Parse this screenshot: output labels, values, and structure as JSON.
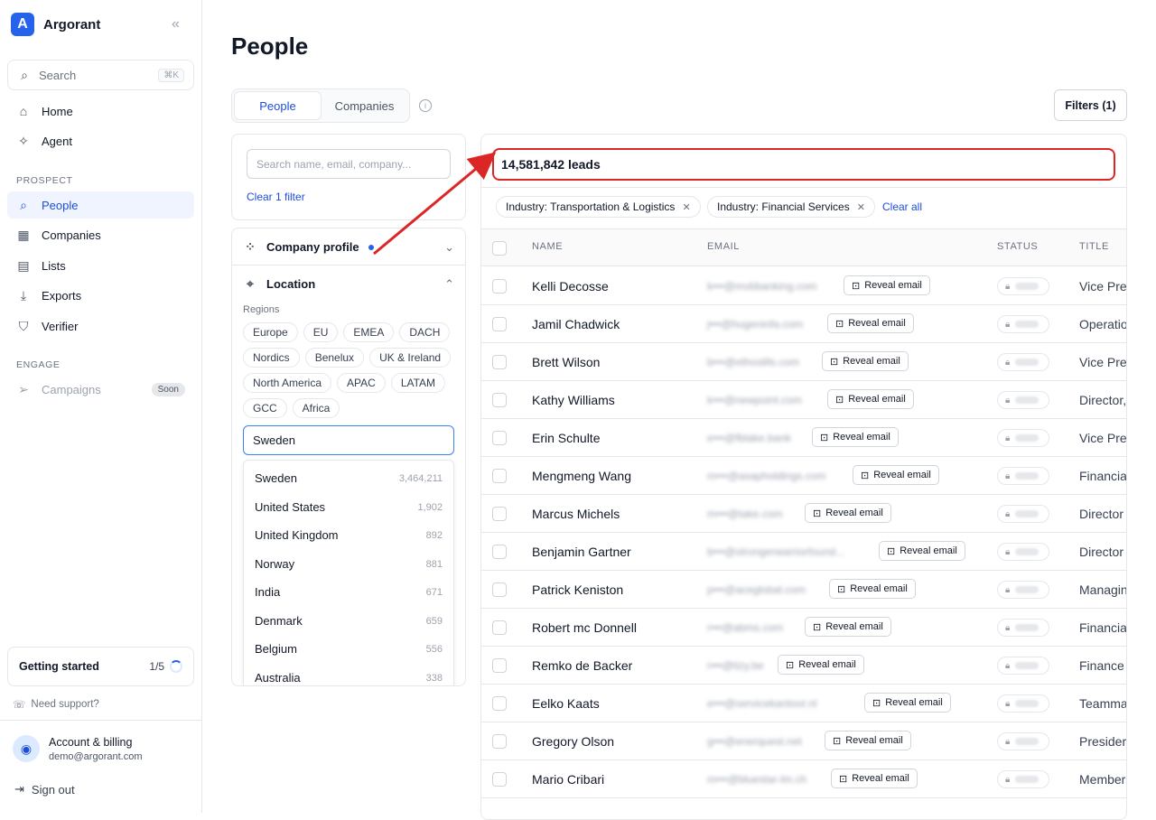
{
  "app": {
    "name": "Argorant"
  },
  "sidebar": {
    "search_placeholder": "Search",
    "search_shortcut": "⌘K",
    "top_items": [
      {
        "label": "Home",
        "icon": "home-icon"
      },
      {
        "label": "Agent",
        "icon": "sparkle-icon"
      }
    ],
    "prospect_label": "PROSPECT",
    "prospect_items": [
      {
        "label": "People",
        "icon": "search-icon",
        "active": true
      },
      {
        "label": "Companies",
        "icon": "building-icon"
      },
      {
        "label": "Lists",
        "icon": "book-icon"
      },
      {
        "label": "Exports",
        "icon": "download-icon"
      },
      {
        "label": "Verifier",
        "icon": "shield-icon"
      }
    ],
    "engage_label": "ENGAGE",
    "engage_items": [
      {
        "label": "Campaigns",
        "icon": "send-icon",
        "badge": "Soon"
      }
    ],
    "getting_started": {
      "label": "Getting started",
      "progress": "1/5"
    },
    "support": "Need support?",
    "account": {
      "title": "Account & billing",
      "email": "demo@argorant.com"
    },
    "signout": "Sign out"
  },
  "main": {
    "title": "People",
    "tabs": [
      {
        "label": "People",
        "active": true
      },
      {
        "label": "Companies"
      }
    ],
    "filters_button": "Filters (1)",
    "filter_search_placeholder": "Search name, email, company...",
    "clear_filter": "Clear 1 filter",
    "company_profile": "Company profile",
    "location": "Location",
    "regions_label": "Regions",
    "regions": [
      "Europe",
      "EU",
      "EMEA",
      "DACH",
      "Nordics",
      "Benelux",
      "UK & Ireland",
      "North America",
      "APAC",
      "LATAM",
      "GCC",
      "Africa"
    ],
    "location_input": "Sweden",
    "dropdown": [
      {
        "label": "Sweden",
        "count": "3,464,211"
      },
      {
        "label": "United States",
        "count": "1,902"
      },
      {
        "label": "United Kingdom",
        "count": "892"
      },
      {
        "label": "Norway",
        "count": "881"
      },
      {
        "label": "India",
        "count": "671"
      },
      {
        "label": "Denmark",
        "count": "659"
      },
      {
        "label": "Belgium",
        "count": "556"
      },
      {
        "label": "Australia",
        "count": "338"
      }
    ]
  },
  "results": {
    "leads": "14,581,842 leads",
    "chips": [
      "Industry: Transportation & Logistics",
      "Industry: Financial Services"
    ],
    "clear_all": "Clear all",
    "columns": [
      "NAME",
      "EMAIL",
      "STATUS",
      "TITLE"
    ],
    "reveal_label": "Reveal email",
    "rows": [
      {
        "name": "Kelli Decosse",
        "email": "k•••@mvbbanking.com",
        "title": "Vice Pre"
      },
      {
        "name": "Jamil Chadwick",
        "email": "j•••@hugeninfa.com",
        "title": "Operatio"
      },
      {
        "name": "Brett Wilson",
        "email": "b•••@ethoslife.com",
        "title": "Vice Pre"
      },
      {
        "name": "Kathy Williams",
        "email": "k•••@newpoint.com",
        "title": "Director,"
      },
      {
        "name": "Erin Schulte",
        "email": "e•••@fblake.bank",
        "title": "Vice Pre"
      },
      {
        "name": "Mengmeng Wang",
        "email": "m•••@asapholdings.com",
        "title": "Financia"
      },
      {
        "name": "Marcus Michels",
        "email": "m•••@take.com",
        "title": "Director"
      },
      {
        "name": "Benjamin Gartner",
        "email": "b•••@strongerwarriorfound...",
        "title": "Director"
      },
      {
        "name": "Patrick Keniston",
        "email": "p•••@aceglobal.com",
        "title": "Managin"
      },
      {
        "name": "Robert mc Donnell",
        "email": "r•••@abms.com",
        "title": "Financia"
      },
      {
        "name": "Remko de Backer",
        "email": "r•••@tizy.be",
        "title": "Finance"
      },
      {
        "name": "Eelko Kaats",
        "email": "e•••@servicekantoor.nl",
        "title": "Teamma"
      },
      {
        "name": "Gregory Olson",
        "email": "g•••@enerquest.net",
        "title": "Presider"
      },
      {
        "name": "Mario Cribari",
        "email": "m•••@bluestar-lm.ch",
        "title": "Member"
      }
    ]
  },
  "colors": {
    "accent": "#2563eb",
    "annotation": "#dc2626"
  }
}
